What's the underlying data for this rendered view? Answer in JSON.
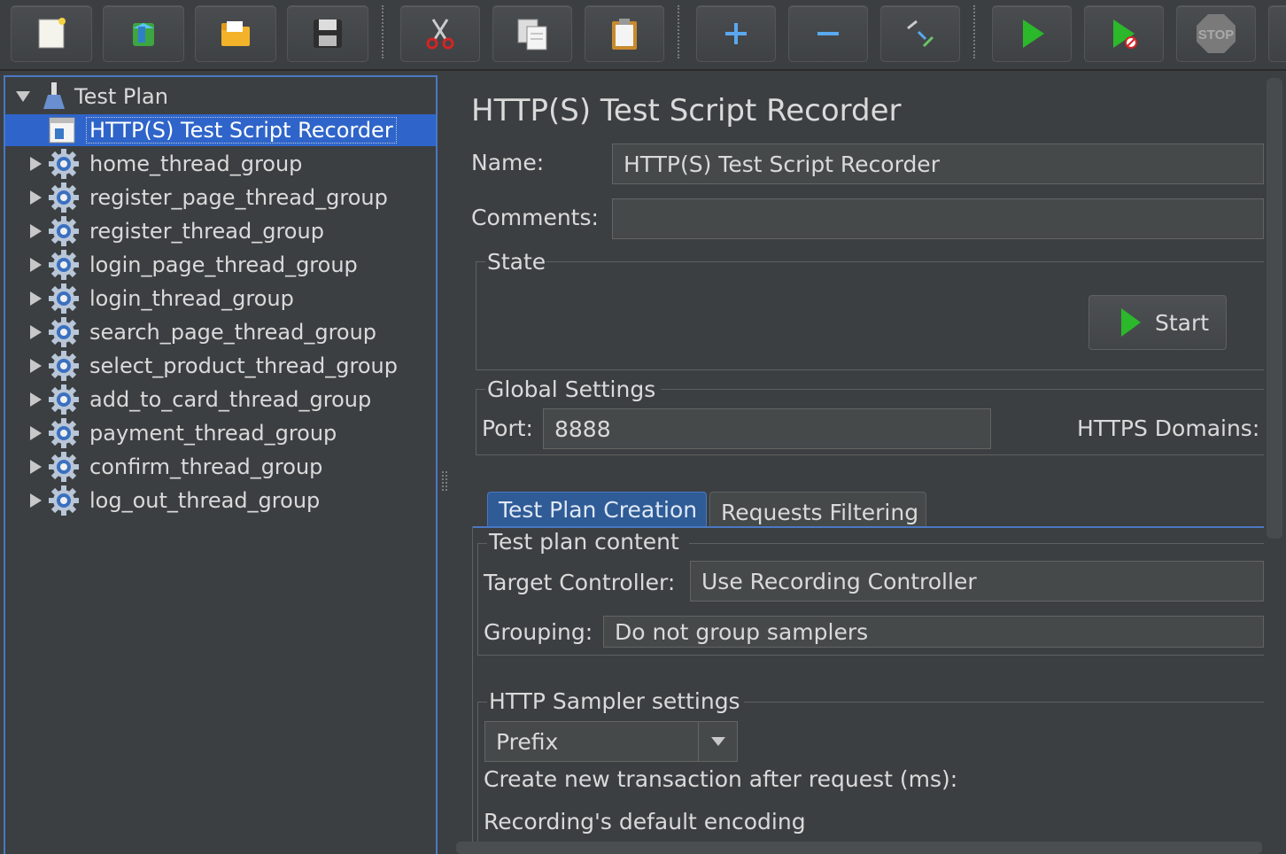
{
  "toolbar": {
    "buttons": [
      {
        "name": "new"
      },
      {
        "name": "templates"
      },
      {
        "name": "open"
      },
      {
        "name": "save"
      },
      {
        "name": "cut"
      },
      {
        "name": "copy"
      },
      {
        "name": "paste"
      },
      {
        "name": "expand"
      },
      {
        "name": "collapse"
      },
      {
        "name": "toggle"
      },
      {
        "name": "start"
      },
      {
        "name": "start-no-pauses"
      },
      {
        "name": "stop"
      }
    ],
    "stop_label": "STOP"
  },
  "tree": {
    "root": "Test Plan",
    "selected": "HTTP(S) Test Script Recorder",
    "items": [
      "home_thread_group",
      "register_page_thread_group",
      "register_thread_group",
      "login_page_thread_group",
      "login_thread_group",
      "search_page_thread_group",
      "select_product_thread_group",
      "add_to_card_thread_group",
      "payment_thread_group",
      "confirm_thread_group",
      "log_out_thread_group"
    ]
  },
  "panel": {
    "title": "HTTP(S) Test Script Recorder",
    "name_label": "Name:",
    "name_value": "HTTP(S) Test Script Recorder",
    "comments_label": "Comments:",
    "comments_value": "",
    "state_label": "State",
    "start_button": "Start",
    "global_label": "Global Settings",
    "port_label": "Port:",
    "port_value": "8888",
    "https_label": "HTTPS Domains:",
    "tabs": [
      "Test Plan Creation",
      "Requests Filtering"
    ],
    "content_label": "Test plan content",
    "target_label": "Target Controller:",
    "target_value": "Use Recording Controller",
    "grouping_label": "Grouping:",
    "grouping_value": "Do not group samplers",
    "sampler_label": "HTTP Sampler settings",
    "prefix_value": "Prefix",
    "transaction_label": "Create new transaction after request (ms):",
    "encoding_label": "Recording's default encoding"
  },
  "colors": {
    "background": "#3c3f41",
    "selection": "#2f65ca",
    "focus_border": "#4a78c2",
    "text": "#dadada"
  }
}
